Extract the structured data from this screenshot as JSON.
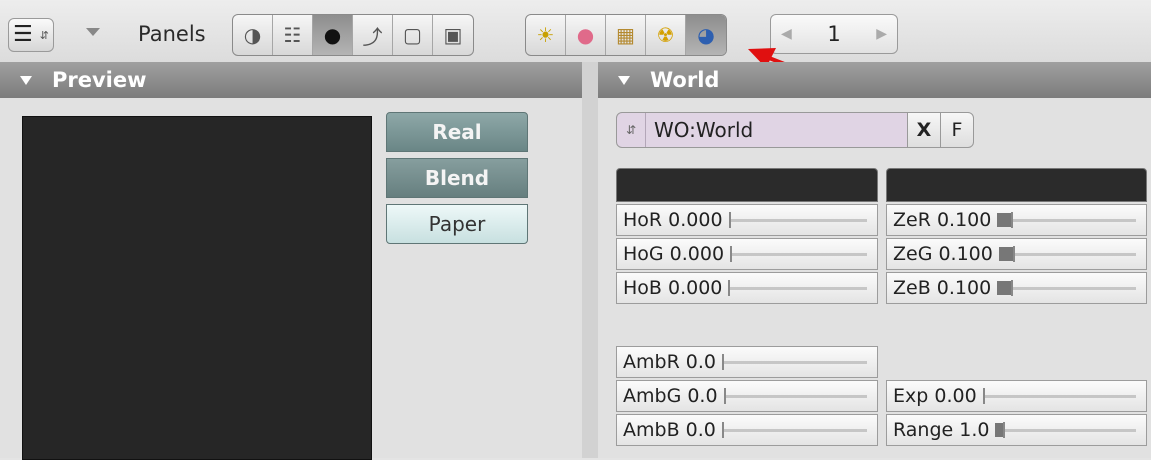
{
  "header": {
    "panels_label": "Panels",
    "editor_type_icon": "buttons-window-icon",
    "context_buttons": [
      {
        "icon": "logic-icon",
        "glyph": "◑",
        "active": false
      },
      {
        "icon": "script-icon",
        "glyph": "☷",
        "active": false
      },
      {
        "icon": "shading-icon",
        "glyph": "●",
        "active": true
      },
      {
        "icon": "object-icon",
        "glyph": "⤴",
        "active": false
      },
      {
        "icon": "editing-icon",
        "glyph": "▢",
        "active": false
      },
      {
        "icon": "scene-icon",
        "glyph": "▣",
        "active": false
      }
    ],
    "shading_buttons": [
      {
        "icon": "lamp-icon",
        "glyph": "☀",
        "color": "#c8a000",
        "active": false
      },
      {
        "icon": "material-icon",
        "glyph": "●",
        "color": "#e06a8a",
        "active": false
      },
      {
        "icon": "texture-icon",
        "glyph": "▦",
        "color": "#b48a30",
        "active": false
      },
      {
        "icon": "radiosity-icon",
        "glyph": "☢",
        "color": "#d4a000",
        "active": false
      },
      {
        "icon": "world-icon",
        "glyph": "◕",
        "color": "#2d5fb0",
        "active": true
      }
    ],
    "frame_value": "1",
    "annotation_arrow_color": "#e01010"
  },
  "preview": {
    "title": "Preview",
    "buttons": [
      "Real",
      "Blend",
      "Paper"
    ]
  },
  "world": {
    "title": "World",
    "datablock_name": "WO:World",
    "unlink_label": "X",
    "fake_user_label": "F",
    "horizon_color": "#2b2b2b",
    "zenith_color": "#2b2b2b",
    "horizon": [
      {
        "label": "HoR 0.000",
        "value": 0.0
      },
      {
        "label": "HoG 0.000",
        "value": 0.0
      },
      {
        "label": "HoB 0.000",
        "value": 0.0
      }
    ],
    "zenith": [
      {
        "label": "ZeR 0.100",
        "value": 0.1
      },
      {
        "label": "ZeG 0.100",
        "value": 0.1
      },
      {
        "label": "ZeB 0.100",
        "value": 0.1
      }
    ],
    "ambient": [
      {
        "label": "AmbR 0.0",
        "value": 0.0
      },
      {
        "label": "AmbG 0.0",
        "value": 0.0
      },
      {
        "label": "AmbB 0.0",
        "value": 0.0
      }
    ],
    "exposure": {
      "label": "Exp 0.00",
      "value": 0.0
    },
    "range": {
      "label": "Range 1.0",
      "value": 0.05
    }
  }
}
